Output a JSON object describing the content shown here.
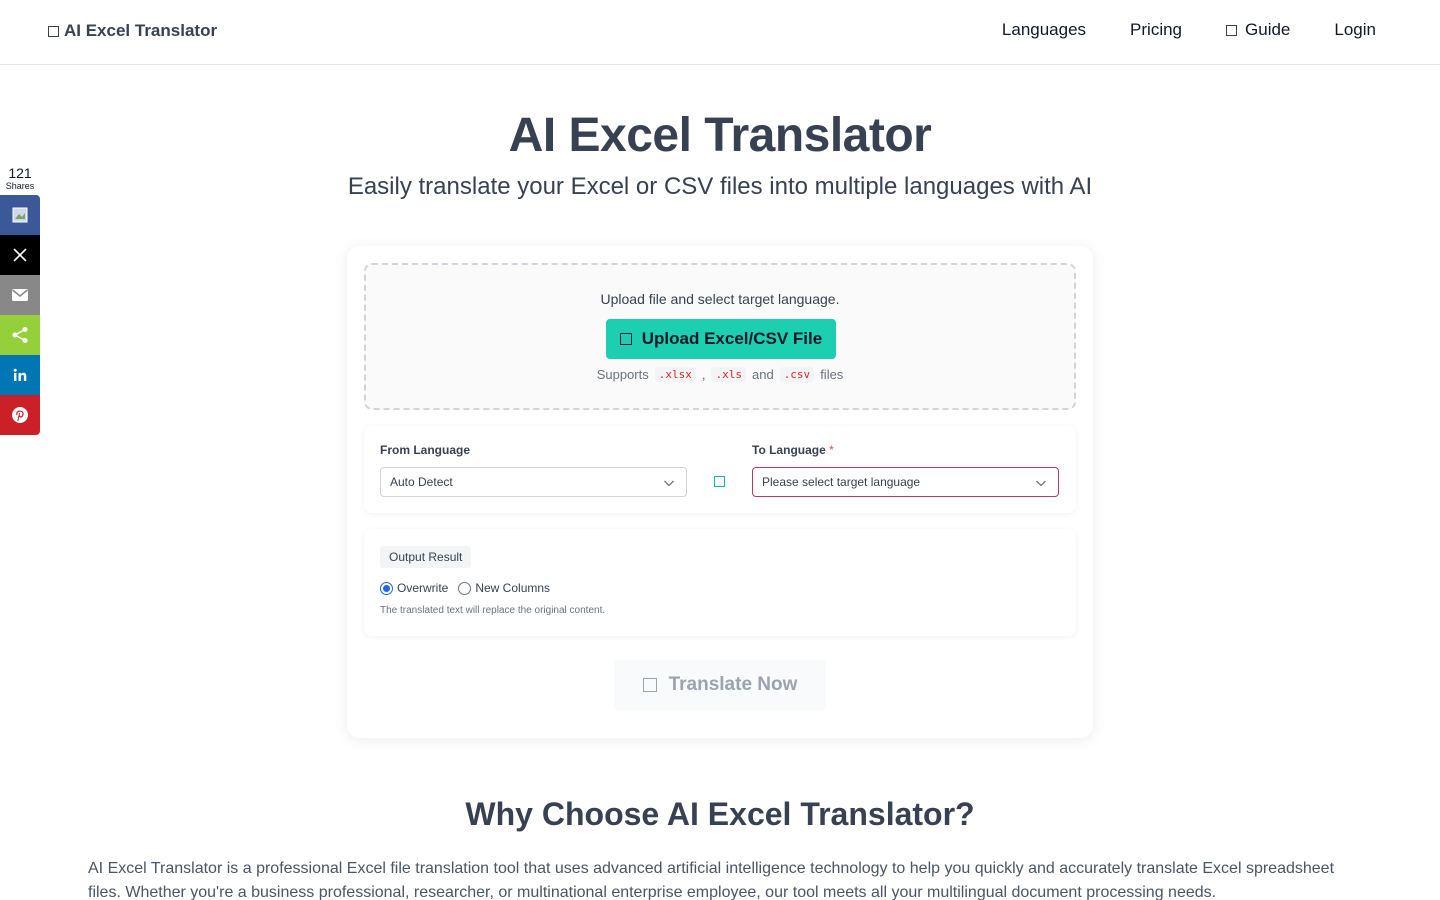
{
  "header": {
    "brand": "AI Excel Translator",
    "nav": {
      "languages": "Languages",
      "pricing": "Pricing",
      "guide": "Guide",
      "login": "Login"
    }
  },
  "share": {
    "count": "121",
    "label": "Shares",
    "buttons": [
      "facebook",
      "x",
      "email",
      "share",
      "linkedin",
      "pinterest"
    ]
  },
  "hero": {
    "title": "AI Excel Translator",
    "subtitle": "Easily translate your Excel or CSV files into multiple languages with AI"
  },
  "upload": {
    "instruction": "Upload file and select target language.",
    "button": "Upload Excel/CSV File",
    "supports_prefix": "Supports",
    "ext_xlsx": ".xlsx",
    "sep_comma": ",",
    "ext_xls": ".xls",
    "sep_and": "and",
    "ext_csv": ".csv",
    "supports_suffix": "files"
  },
  "languages": {
    "from_label": "From Language",
    "from_value": "Auto Detect",
    "to_label": "To Language",
    "to_required": "*",
    "to_placeholder": "Please select target language"
  },
  "output": {
    "tag": "Output Result",
    "options": [
      "Overwrite",
      "New Columns"
    ],
    "selected": "Overwrite",
    "help": "The translated text will replace the original content."
  },
  "translate": {
    "button": "Translate Now"
  },
  "why": {
    "title": "Why Choose AI Excel Translator?",
    "text": "AI Excel Translator is a professional Excel file translation tool that uses advanced artificial intelligence technology to help you quickly and accurately translate Excel spreadsheet files. Whether you're a business professional, researcher, or multinational enterprise employee, our tool meets all your multilingual document processing needs."
  },
  "colors": {
    "accent": "#1bcfb0",
    "text": "#374151",
    "error_border": "#c0395b"
  }
}
